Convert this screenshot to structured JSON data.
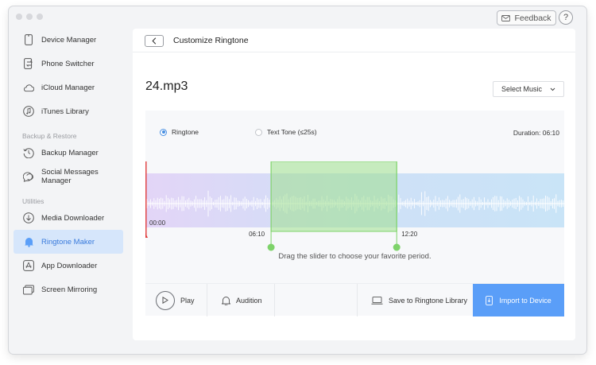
{
  "header": {
    "feedback_label": "Feedback",
    "help_label": "?"
  },
  "sidebar": {
    "items": [
      {
        "label": "Device Manager",
        "icon": "phone-icon"
      },
      {
        "label": "Phone Switcher",
        "icon": "switch-icon"
      },
      {
        "label": "iCloud Manager",
        "icon": "cloud-icon"
      },
      {
        "label": "iTunes Library",
        "icon": "music-icon"
      }
    ],
    "section_backup": "Backup & Restore",
    "backup_items": [
      {
        "label": "Backup Manager",
        "icon": "history-icon"
      },
      {
        "label": "Social Messages Manager",
        "icon": "chat-icon"
      }
    ],
    "section_utilities": "Utilities",
    "utility_items": [
      {
        "label": "Media Downloader",
        "icon": "download-icon"
      },
      {
        "label": "Ringtone Maker",
        "icon": "bell-icon",
        "active": true
      },
      {
        "label": "App Downloader",
        "icon": "app-store-icon"
      },
      {
        "label": "Screen Mirroring",
        "icon": "mirror-icon"
      }
    ],
    "collapse_glyph": "<"
  },
  "main": {
    "title": "Customize Ringtone",
    "file_name": "24.mp3",
    "select_music_label": "Select Music",
    "ringtone_label": "Ringtone",
    "text_tone_label": "Text Tone (≤25s)",
    "selected_mode": "Ringtone",
    "duration_label": "Duration: 06:10",
    "time_start": "00:00",
    "time_sel_start": "06:10",
    "time_sel_end": "12:20",
    "selection_start_fraction": 0.3,
    "selection_end_fraction": 0.6,
    "hint": "Drag the slider to choose your favorite period.",
    "actions": {
      "play_label": "Play",
      "audition_label": "Audition",
      "save_label": "Save to Ringtone Library",
      "import_label": "Import to Device"
    }
  },
  "colors": {
    "accent": "#4a90e2",
    "active_bg": "#d6e6fb",
    "selection_green": "#7ed36a",
    "import_button": "#5a9ef8",
    "playhead_red": "#e03a3a"
  }
}
